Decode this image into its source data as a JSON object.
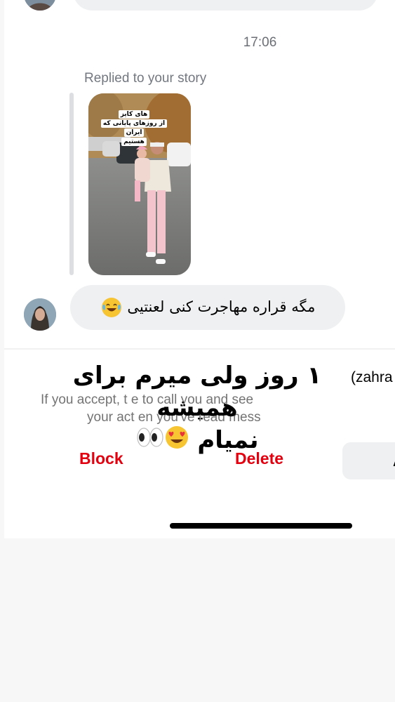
{
  "conversation": {
    "timestamp": "17:06",
    "reply_note": "Replied to your story",
    "story": {
      "caption_line1": "های کایز",
      "caption_line2": "از روزهای پایانی که ایران",
      "caption_line3": "هستیم"
    },
    "message": {
      "text": "مگه قراره مهاجرت کنی لعنتیی",
      "emoji": "tears-of-joy"
    }
  },
  "request": {
    "sender_name": "(zahra",
    "info_line1": "If you accept, t                              e to call you and see",
    "info_line2": "your act                               en you've read mess",
    "actions": {
      "block_label": "Block",
      "delete_label": "Delete",
      "accept_label": "A"
    }
  },
  "overlay": {
    "line1": "۱ روز ولی میرم برای همیشه",
    "line2": "نمیام",
    "emojis": [
      "heart-eyes",
      "eyes"
    ]
  },
  "colors": {
    "bubble": "#eff0f2",
    "danger": "#e3000f",
    "muted_text": "#737880"
  }
}
